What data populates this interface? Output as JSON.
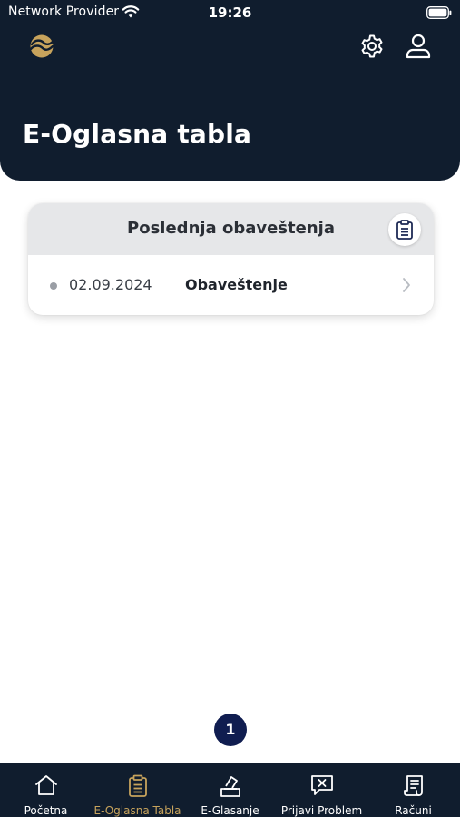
{
  "status_bar": {
    "carrier": "Network Provider",
    "time": "19:26"
  },
  "header": {
    "title": "E-Oglasna tabla",
    "logo_icon": "swirl-logo-icon",
    "settings_icon": "gear-icon",
    "profile_icon": "user-icon"
  },
  "card": {
    "title": "Poslednja obaveštenja",
    "icon": "clipboard-icon",
    "items": [
      {
        "date": "02.09.2024",
        "label": "Obaveštenje"
      }
    ]
  },
  "pagination": {
    "current_page": "1"
  },
  "tab_bar": {
    "items": [
      {
        "label": "Početna",
        "icon": "home-icon",
        "active": false
      },
      {
        "label": "E-Oglasna Tabla",
        "icon": "clipboard-icon",
        "active": true
      },
      {
        "label": "E-Glasanje",
        "icon": "ballot-box-icon",
        "active": false
      },
      {
        "label": "Prijavi Problem",
        "icon": "report-problem-icon",
        "active": false
      },
      {
        "label": "Računi",
        "icon": "receipt-icon",
        "active": false
      }
    ]
  },
  "colors": {
    "header_bg": "#101d2e",
    "accent_gold": "#c7a35c",
    "page_bubble": "#101d50",
    "card_header_bg": "#e6e7e9"
  }
}
